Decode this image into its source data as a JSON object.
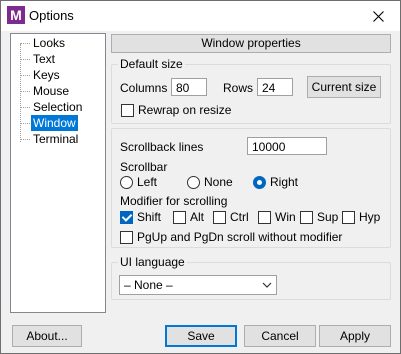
{
  "window": {
    "title": "Options",
    "icon_letter": "M",
    "accent": "#7b2c8e"
  },
  "tree": {
    "items": [
      {
        "label": "Looks",
        "selected": false
      },
      {
        "label": "Text",
        "selected": false
      },
      {
        "label": "Keys",
        "selected": false
      },
      {
        "label": "Mouse",
        "selected": false
      },
      {
        "label": "Selection",
        "selected": false
      },
      {
        "label": "Window",
        "selected": true
      },
      {
        "label": "Terminal",
        "selected": false
      }
    ]
  },
  "panel": {
    "header": "Window properties"
  },
  "default_size": {
    "title": "Default size",
    "columns_label": "Columns",
    "columns_value": "80",
    "rows_label": "Rows",
    "rows_value": "24",
    "current_size_button": "Current size",
    "rewrap_label": "Rewrap on resize",
    "rewrap_checked": false
  },
  "scroll": {
    "scrollback_label": "Scrollback lines",
    "scrollback_value": "10000",
    "scrollbar_label": "Scrollbar",
    "scrollbar_options": [
      {
        "label": "Left",
        "checked": false
      },
      {
        "label": "None",
        "checked": false
      },
      {
        "label": "Right",
        "checked": true
      }
    ],
    "modifier_label": "Modifier for scrolling",
    "modifiers": [
      {
        "label": "Shift",
        "checked": true
      },
      {
        "label": "Alt",
        "checked": false
      },
      {
        "label": "Ctrl",
        "checked": false
      },
      {
        "label": "Win",
        "checked": false
      },
      {
        "label": "Sup",
        "checked": false
      },
      {
        "label": "Hyp",
        "checked": false
      }
    ],
    "pgup_label": "PgUp and PgDn scroll without modifier",
    "pgup_checked": false
  },
  "ui_language": {
    "title": "UI language",
    "value": "– None –"
  },
  "buttons": {
    "about": "About...",
    "save": "Save",
    "cancel": "Cancel",
    "apply": "Apply"
  }
}
